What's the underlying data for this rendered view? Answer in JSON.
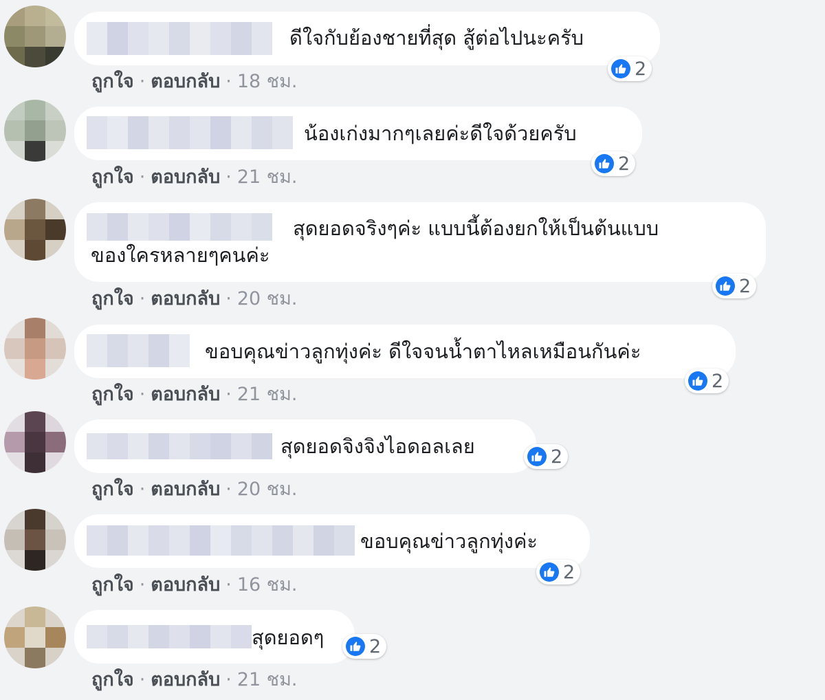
{
  "comments": [
    {
      "text": "ดีใจกับย้องชายที่สุด สู้ต่อไปนะครับ",
      "likes": "2",
      "like_label": "ถูกใจ",
      "reply_label": "ตอบกลับ",
      "time": "18 ชม."
    },
    {
      "text": "น้องเก่งมากๆเลยค่ะดีใจด้วยครับ",
      "likes": "2",
      "like_label": "ถูกใจ",
      "reply_label": "ตอบกลับ",
      "time": "21 ชม."
    },
    {
      "text": "สุดยอดจริงๆค่ะ แบบนี้ต้องยกให้เป็นต้นแบบ",
      "text2": "ของใครหลายๆคนค่ะ",
      "likes": "2",
      "like_label": "ถูกใจ",
      "reply_label": "ตอบกลับ",
      "time": "20 ชม."
    },
    {
      "text": "ขอบคุณข่าวลูกทุ่งค่ะ ดีใจจนน้ำตาไหลเหมือนกันค่ะ",
      "likes": "2",
      "like_label": "ถูกใจ",
      "reply_label": "ตอบกลับ",
      "time": "21 ชม."
    },
    {
      "text": "สุดยอดจิงจิงไอดอลเลย",
      "likes": "2",
      "like_label": "ถูกใจ",
      "reply_label": "ตอบกลับ",
      "time": "20 ชม."
    },
    {
      "text": "ขอบคุณข่าวลูกทุ่งค่ะ",
      "likes": "2",
      "like_label": "ถูกใจ",
      "reply_label": "ตอบกลับ",
      "time": "16 ชม."
    },
    {
      "text": "สุดยอดๆ",
      "likes": "2",
      "like_label": "ถูกใจ",
      "reply_label": "ตอบกลับ",
      "time": "21 ชม."
    }
  ],
  "separator": "·",
  "colors": {
    "like_blue": "#1877f2",
    "bubble_bg": "#ffffff",
    "page_bg": "#f2f3f5"
  },
  "icons": {
    "reaction": "thumbs-up-icon"
  }
}
